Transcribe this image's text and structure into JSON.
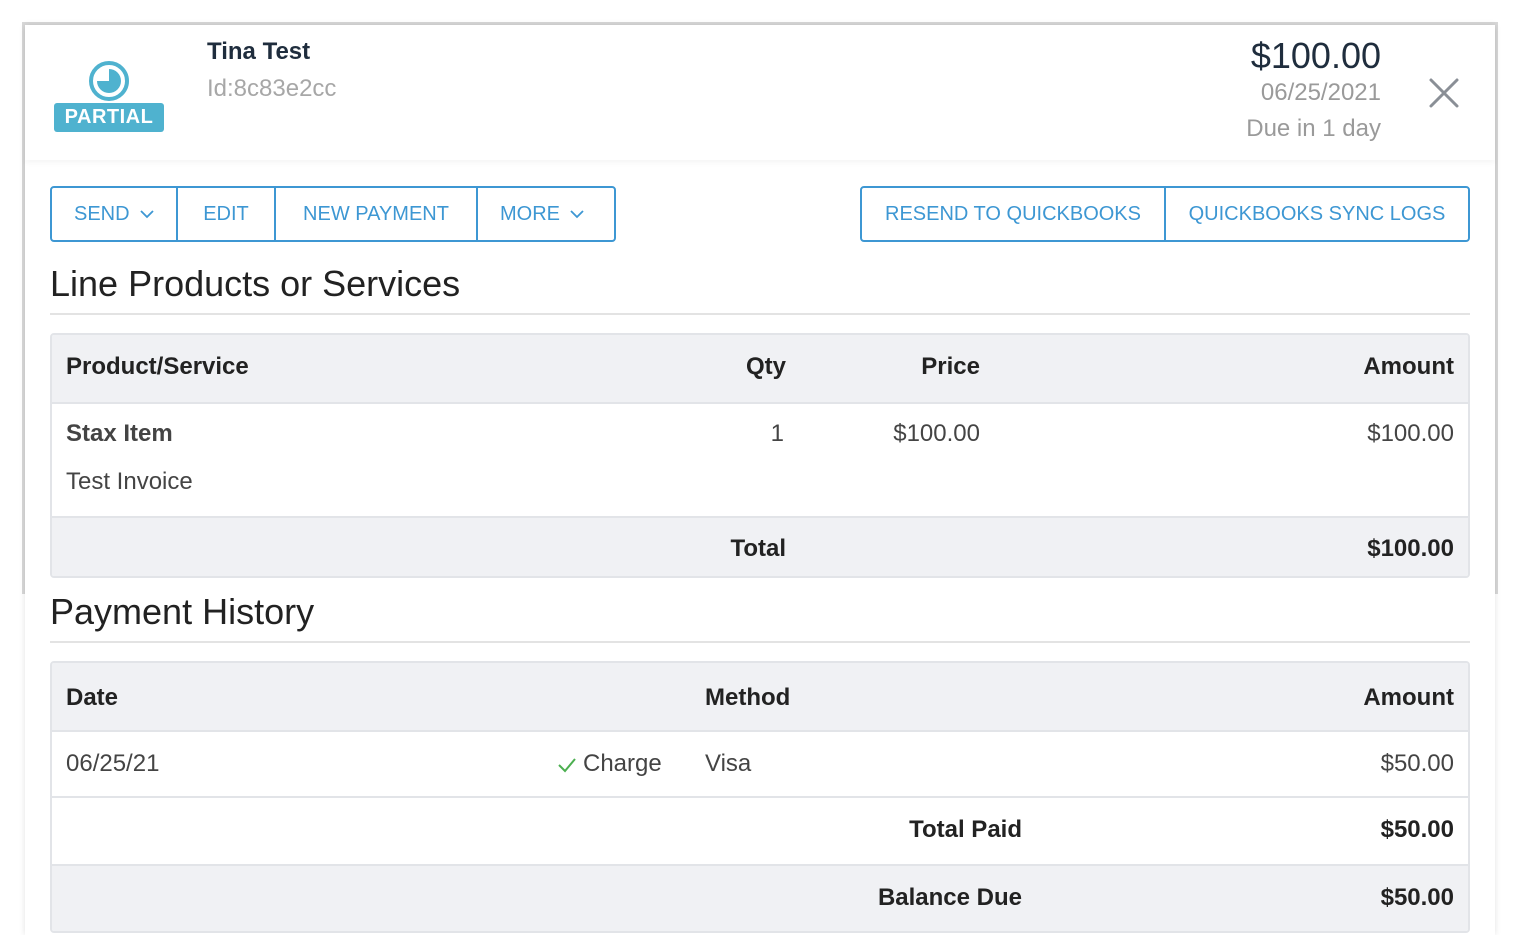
{
  "header": {
    "status_badge": "PARTIAL",
    "customer_name": "Tina Test",
    "invoice_id": "Id:8c83e2cc",
    "amount": "$100.00",
    "date": "06/25/2021",
    "due_text": "Due in 1 day",
    "status_color": "#4fb2cf"
  },
  "actions": {
    "send": "SEND",
    "edit": "EDIT",
    "new_payment": "NEW PAYMENT",
    "more": "MORE",
    "resend_quickbooks": "RESEND TO QUICKBOOKS",
    "quickbooks_sync_logs": "QUICKBOOKS SYNC LOGS",
    "accent_color": "#3d97d3"
  },
  "line_items": {
    "title": "Line Products or Services",
    "columns": [
      "Product/Service",
      "Qty",
      "Price",
      "Amount"
    ],
    "rows": [
      {
        "name": "Stax Item",
        "description": "Test Invoice",
        "qty": "1",
        "price": "$100.00",
        "amount": "$100.00"
      }
    ],
    "total_label": "Total",
    "total_value": "$100.00"
  },
  "payment_history": {
    "title": "Payment History",
    "columns": [
      "Date",
      "Method",
      "Amount"
    ],
    "rows": [
      {
        "date": "06/25/21",
        "type": "Charge",
        "method": "Visa",
        "amount": "$50.00"
      }
    ],
    "total_paid_label": "Total Paid",
    "total_paid_value": "$50.00",
    "balance_due_label": "Balance Due",
    "balance_due_value": "$50.00"
  }
}
